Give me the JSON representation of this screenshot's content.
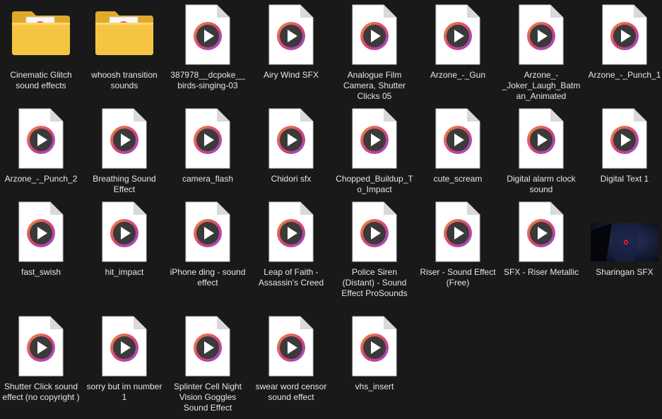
{
  "files": [
    {
      "label": "Cinematic Glitch sound effects",
      "type": "folder",
      "icon": "folder-icon"
    },
    {
      "label": "whoosh transition sounds",
      "type": "folder",
      "icon": "folder-icon"
    },
    {
      "label": "387978__dcpoke__birds-singing-03",
      "type": "audio",
      "icon": "audio-file-icon"
    },
    {
      "label": "Airy Wind SFX",
      "type": "audio",
      "icon": "audio-file-icon"
    },
    {
      "label": "Analogue Film Camera, Shutter Clicks 05",
      "type": "audio",
      "icon": "audio-file-icon"
    },
    {
      "label": "Arzone_-_Gun",
      "type": "audio",
      "icon": "audio-file-icon"
    },
    {
      "label": "Arzone_-_Joker_Laugh_Batman_Animated",
      "type": "audio",
      "icon": "audio-file-icon"
    },
    {
      "label": "Arzone_-_Punch_1",
      "type": "audio",
      "icon": "audio-file-icon"
    },
    {
      "label": "Arzone_-_Punch_2",
      "type": "audio",
      "icon": "audio-file-icon"
    },
    {
      "label": "Breathing Sound Effect",
      "type": "audio",
      "icon": "audio-file-icon"
    },
    {
      "label": "camera_flash",
      "type": "audio",
      "icon": "audio-file-icon"
    },
    {
      "label": "Chidori sfx",
      "type": "audio",
      "icon": "audio-file-icon"
    },
    {
      "label": "Chopped_Buildup_To_Impact",
      "type": "audio",
      "icon": "audio-file-icon"
    },
    {
      "label": "cute_scream",
      "type": "audio",
      "icon": "audio-file-icon"
    },
    {
      "label": "Digital alarm clock sound",
      "type": "audio",
      "icon": "audio-file-icon"
    },
    {
      "label": "Digital Text 1",
      "type": "audio",
      "icon": "audio-file-icon"
    },
    {
      "label": "fast_swish",
      "type": "audio",
      "icon": "audio-file-icon"
    },
    {
      "label": "hit_impact",
      "type": "audio",
      "icon": "audio-file-icon"
    },
    {
      "label": "iPhone ding - sound effect",
      "type": "audio",
      "icon": "audio-file-icon"
    },
    {
      "label": "Leap of Faith - Assassin's Creed",
      "type": "audio",
      "icon": "audio-file-icon"
    },
    {
      "label": "Police Siren (Distant) - Sound Effect ProSounds",
      "type": "audio",
      "icon": "audio-file-icon"
    },
    {
      "label": "Riser - Sound Effect (Free)",
      "type": "audio",
      "icon": "audio-file-icon"
    },
    {
      "label": "SFX - Riser Metallic",
      "type": "audio",
      "icon": "audio-file-icon"
    },
    {
      "label": "Sharingan SFX",
      "type": "video",
      "icon": "video-thumbnail-icon"
    },
    {
      "label": "Shutter Click sound effect (no copyright )",
      "type": "audio",
      "icon": "audio-file-icon"
    },
    {
      "label": "sorry but im number 1",
      "type": "audio",
      "icon": "audio-file-icon"
    },
    {
      "label": "Splinter Cell Night Vision Goggles Sound Effect",
      "type": "audio",
      "icon": "audio-file-icon"
    },
    {
      "label": "swear word censor sound effect",
      "type": "audio",
      "icon": "audio-file-icon"
    },
    {
      "label": "vhs_insert",
      "type": "audio",
      "icon": "audio-file-icon"
    }
  ],
  "colors": {
    "background": "#191919",
    "text": "#e6e6e6",
    "folder": "#f5c542",
    "play_ring_start": "#f08a3a",
    "play_ring_end": "#8a4fd8"
  }
}
